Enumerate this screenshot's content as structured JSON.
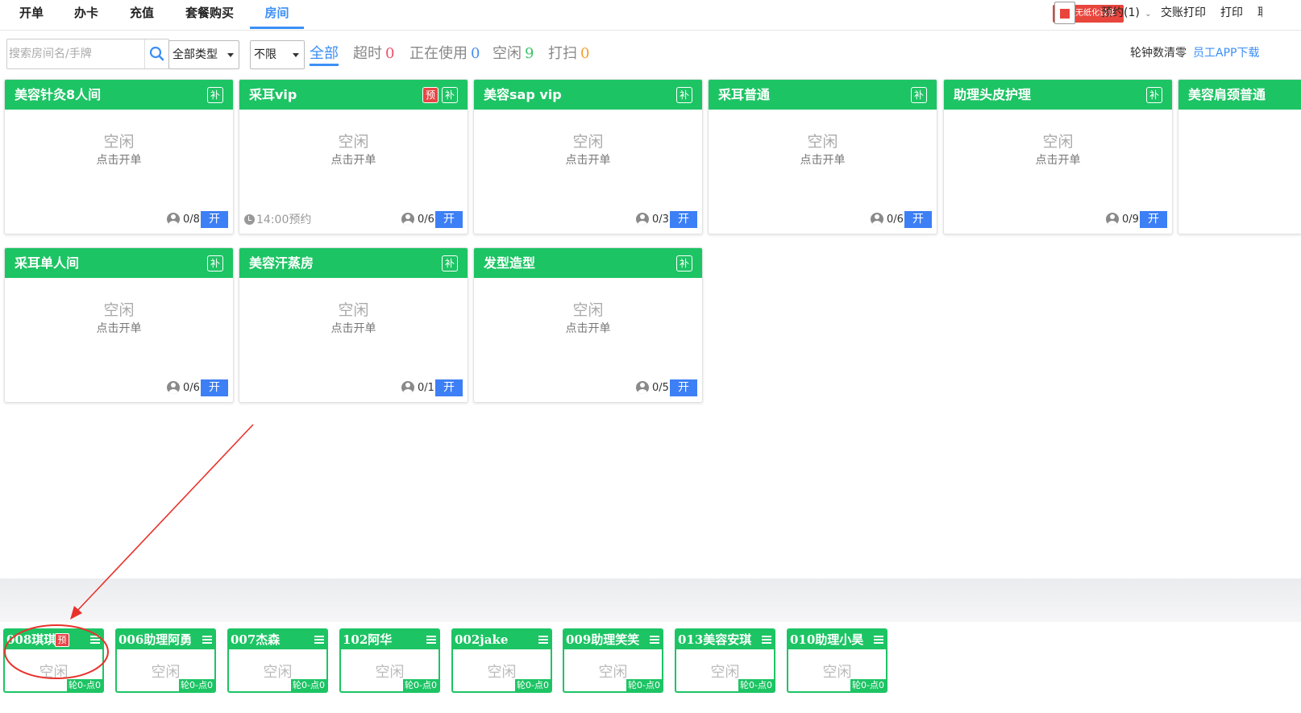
{
  "nav": {
    "tabs": [
      "开单",
      "办卡",
      "充值",
      "套餐购买",
      "房间"
    ],
    "active_tab": "房间",
    "device_badge": "无纸化设备",
    "reservation": "预约(1)",
    "handover_print": "交账打印",
    "print": "打印",
    "cutoff_char": "耶"
  },
  "toolbar": {
    "search_placeholder": "搜索房间名/手牌",
    "type_select": "全部类型",
    "limit_select": "不限",
    "filters": [
      {
        "label": "全部",
        "count": "",
        "count_color": ""
      },
      {
        "label": "超时",
        "count": "0",
        "count_color": "#f0506e"
      },
      {
        "label": "正在使用",
        "count": "0",
        "count_color": "#4a90f0"
      },
      {
        "label": "空闲",
        "count": "9",
        "count_color": "#3cc46a"
      },
      {
        "label": "打扫",
        "count": "0",
        "count_color": "#f0a030"
      }
    ],
    "clear_label": "轮钟数清零",
    "app_download": "员工APP下载"
  },
  "rooms": [
    {
      "name": "美容针灸8人间",
      "status": "空闲",
      "hint": "点击开单",
      "occupancy": "0/8",
      "reserved": false,
      "reserve_text": ""
    },
    {
      "name": "采耳vip",
      "status": "空闲",
      "hint": "点击开单",
      "occupancy": "0/6",
      "reserved": true,
      "reserve_text": "14:00预约"
    },
    {
      "name": "美容sap vip",
      "status": "空闲",
      "hint": "点击开单",
      "occupancy": "0/3",
      "reserved": false,
      "reserve_text": ""
    },
    {
      "name": "采耳普通",
      "status": "空闲",
      "hint": "点击开单",
      "occupancy": "0/6",
      "reserved": false,
      "reserve_text": ""
    },
    {
      "name": "助理头皮护理",
      "status": "空闲",
      "hint": "点击开单",
      "occupancy": "0/9",
      "reserved": false,
      "reserve_text": ""
    },
    {
      "name": "美容肩颈普通",
      "status": "",
      "hint": "",
      "occupancy": "",
      "reserved": false,
      "reserve_text": ""
    },
    {
      "name": "采耳单人间",
      "status": "空闲",
      "hint": "点击开单",
      "occupancy": "0/6",
      "reserved": false,
      "reserve_text": ""
    },
    {
      "name": "美容汗蒸房",
      "status": "空闲",
      "hint": "点击开单",
      "occupancy": "0/1",
      "reserved": false,
      "reserve_text": ""
    },
    {
      "name": "发型造型",
      "status": "空闲",
      "hint": "点击开单",
      "occupancy": "0/5",
      "reserved": false,
      "reserve_text": ""
    }
  ],
  "badges": {
    "supplement": "补",
    "reserve": "预",
    "open": "开"
  },
  "staff": [
    {
      "name": "008琪琪",
      "reserved": true,
      "status": "空闲",
      "count": "轮0-点0"
    },
    {
      "name": "006助理阿勇",
      "reserved": false,
      "status": "空闲",
      "count": "轮0-点0"
    },
    {
      "name": "007杰森",
      "reserved": false,
      "status": "空闲",
      "count": "轮0-点0"
    },
    {
      "name": "102阿华",
      "reserved": false,
      "status": "空闲",
      "count": "轮0-点0"
    },
    {
      "name": "002jake",
      "reserved": false,
      "status": "空闲",
      "count": "轮0-点0"
    },
    {
      "name": "009助理笑笑",
      "reserved": false,
      "status": "空闲",
      "count": "轮0-点0"
    },
    {
      "name": "013美容安琪",
      "reserved": false,
      "status": "空闲",
      "count": "轮0-点0"
    },
    {
      "name": "010助理小昊",
      "reserved": false,
      "status": "空闲",
      "count": "轮0-点0"
    }
  ],
  "colors": {
    "accent": "#3b8ff5",
    "room_green": "#1dc464",
    "open_blue": "#3d7ff5",
    "reserve_red": "#e84545",
    "annotation_red": "#e8322b"
  }
}
